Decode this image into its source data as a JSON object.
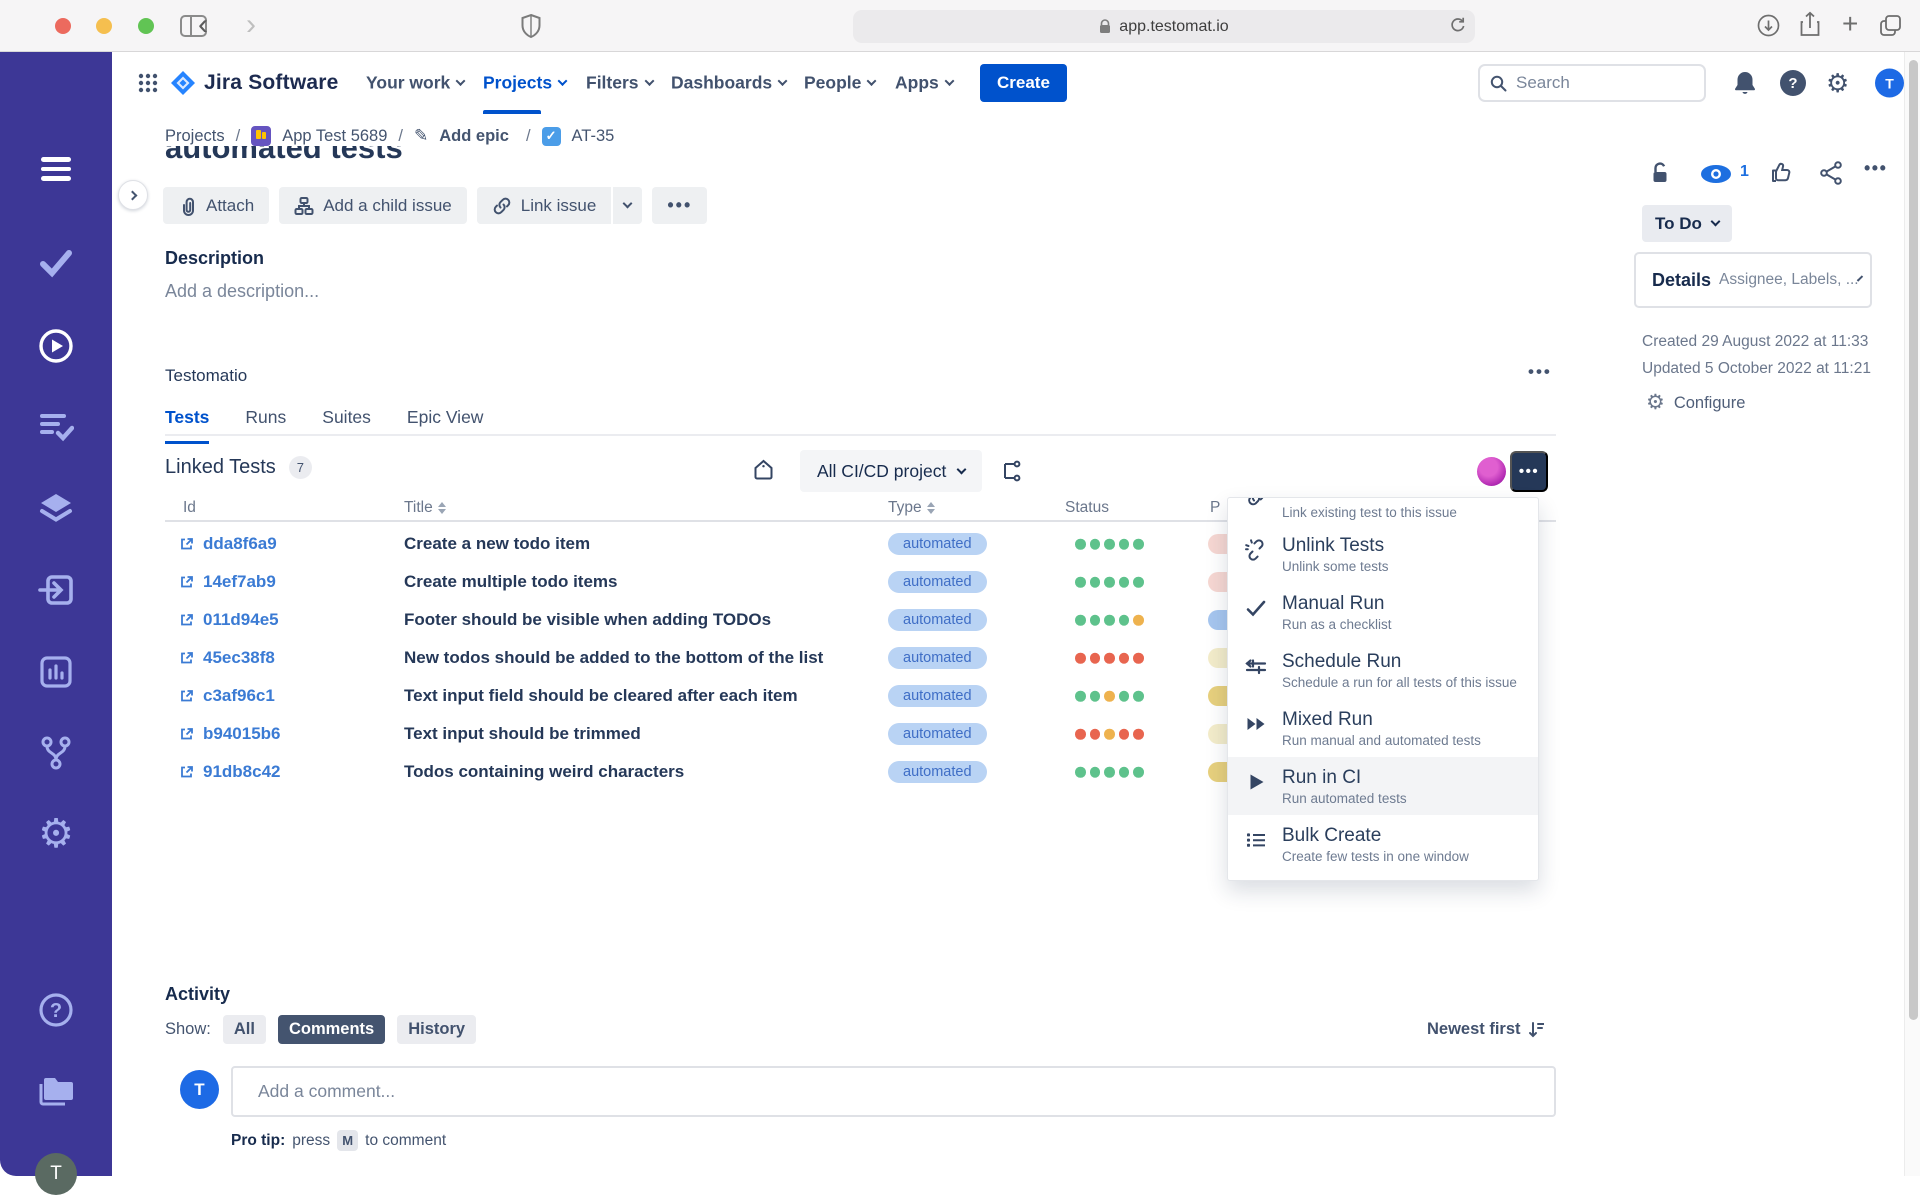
{
  "browser": {
    "url": "app.testomat.io"
  },
  "header": {
    "logo": "Jira Software",
    "nav": [
      "Your work",
      "Projects",
      "Filters",
      "Dashboards",
      "People",
      "Apps"
    ],
    "active_nav": "Projects",
    "create": "Create",
    "search_placeholder": "Search",
    "avatar": "T"
  },
  "breadcrumb": {
    "root": "Projects",
    "project": "App Test 5689",
    "epic": "Add epic",
    "issue": "AT-35"
  },
  "issue": {
    "title": "automated tests",
    "attach": "Attach",
    "add_child": "Add a child issue",
    "link_issue": "Link issue",
    "description_label": "Description",
    "description_placeholder": "Add a description..."
  },
  "testomatio": {
    "title": "Testomatio",
    "tabs": [
      "Tests",
      "Runs",
      "Suites",
      "Epic View"
    ],
    "active_tab": "Tests",
    "linked_label": "Linked Tests",
    "linked_count": "7",
    "project_filter": "All CI/CD project",
    "headers": {
      "id": "Id",
      "title": "Title",
      "type": "Type",
      "status": "Status",
      "partial": "P"
    },
    "status_colors": {
      "green": "#5ec28c",
      "yellow": "#eeb24e",
      "red": "#e8654f"
    },
    "rows": [
      {
        "id": "dda8f6a9",
        "title": "Create a new todo item",
        "type": "automated",
        "dots": [
          "#5ec28c",
          "#5ec28c",
          "#5ec28c",
          "#5ec28c",
          "#5ec28c"
        ],
        "priority": "#f6d7d2"
      },
      {
        "id": "14ef7ab9",
        "title": "Create multiple todo items",
        "type": "automated",
        "dots": [
          "#5ec28c",
          "#5ec28c",
          "#5ec28c",
          "#5ec28c",
          "#5ec28c"
        ],
        "priority": "#f6d7d2"
      },
      {
        "id": "011d94e5",
        "title": "Footer should be visible when adding TODOs",
        "type": "automated",
        "dots": [
          "#5ec28c",
          "#5ec28c",
          "#5ec28c",
          "#5ec28c",
          "#eeb24e"
        ],
        "priority": "#a6c6ef"
      },
      {
        "id": "45ec38f8",
        "title": "New todos should be added to the bottom of the list",
        "type": "automated",
        "dots": [
          "#e8654f",
          "#e8654f",
          "#e8654f",
          "#e8654f",
          "#e8654f"
        ],
        "priority": "#f3ecca"
      },
      {
        "id": "c3af96c1",
        "title": "Text input field should be cleared after each item",
        "type": "automated",
        "dots": [
          "#5ec28c",
          "#5ec28c",
          "#eeb24e",
          "#5ec28c",
          "#5ec28c"
        ],
        "priority": "#e7d07d"
      },
      {
        "id": "b94015b6",
        "title": "Text input should be trimmed",
        "type": "automated",
        "dots": [
          "#e8654f",
          "#e8654f",
          "#eeb24e",
          "#e8654f",
          "#e8654f"
        ],
        "priority": "#f3ecca"
      },
      {
        "id": "91db8c42",
        "title": "Todos containing weird characters",
        "type": "automated",
        "dots": [
          "#5ec28c",
          "#5ec28c",
          "#5ec28c",
          "#5ec28c",
          "#5ec28c"
        ],
        "priority": "#e7d07d"
      }
    ]
  },
  "menu": {
    "partial_subtitle": "Link existing test to this issue",
    "items": [
      {
        "title": "Unlink Tests",
        "subtitle": "Unlink some tests"
      },
      {
        "title": "Manual Run",
        "subtitle": "Run as a checklist"
      },
      {
        "title": "Schedule Run",
        "subtitle": "Schedule a run for all tests of this issue"
      },
      {
        "title": "Mixed Run",
        "subtitle": "Run manual and automated tests"
      },
      {
        "title": "Run in CI",
        "subtitle": "Run automated tests"
      },
      {
        "title": "Bulk Create",
        "subtitle": "Create few tests in one window"
      }
    ],
    "highlighted": "Run in CI"
  },
  "panel": {
    "watchers": "1",
    "status": "To Do",
    "details": "Details",
    "details_hint": "Assignee, Labels, ...",
    "created": "Created 29 August 2022 at 11:33",
    "updated": "Updated 5 October 2022 at 11:21",
    "configure": "Configure"
  },
  "activity": {
    "title": "Activity",
    "show": "Show:",
    "filters": [
      "All",
      "Comments",
      "History"
    ],
    "active_filter": "Comments",
    "sort": "Newest first",
    "avatar": "T",
    "comment_placeholder": "Add a comment...",
    "protip_label": "Pro tip:",
    "protip_pre": "press",
    "protip_key": "M",
    "protip_post": "to comment"
  },
  "colors": {
    "accent": "#0052cc",
    "sidebar": "#3d3796",
    "link": "#3b7bd4"
  }
}
